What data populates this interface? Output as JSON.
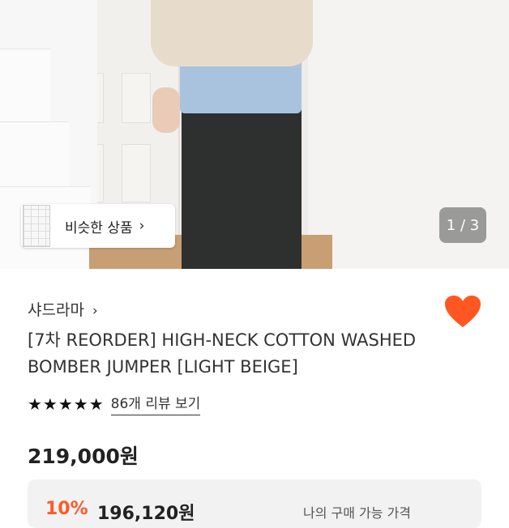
{
  "hero": {
    "counter": "1 / 3",
    "similar_button": {
      "label": "비슷한 상품",
      "chevron": "›"
    }
  },
  "product": {
    "shop_name": "샤드라마",
    "shop_chevron": "›",
    "title": "[7차 REORDER] HIGH-NECK COTTON WASHED BOMBER JUMPER [LIGHT BEIGE]",
    "rating_stars": "★★★★★",
    "review_link": "86개 리뷰 보기",
    "price": "219,000원",
    "wishlist_icon": "heart-icon"
  },
  "promo": {
    "discount": "10%",
    "discount_price": "196,120원",
    "note": "나의 구매 가능 가격"
  },
  "colors": {
    "accent": "#ff5a2a",
    "heart": "#ff5722"
  }
}
